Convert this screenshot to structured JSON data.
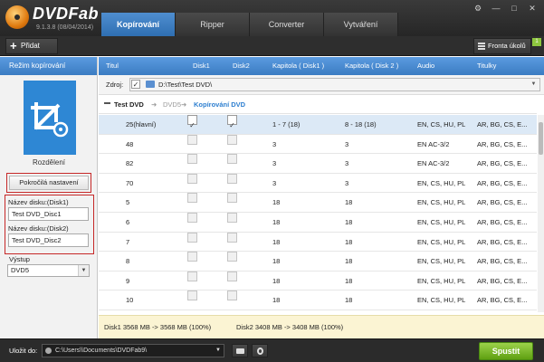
{
  "app": {
    "logo_text": "DVDFab",
    "version": "9.1.3.8 (08/04/2014)"
  },
  "tabs": [
    {
      "label": "Kopírování",
      "active": true
    },
    {
      "label": "Ripper",
      "active": false
    },
    {
      "label": "Converter",
      "active": false
    },
    {
      "label": "Vytváření",
      "active": false
    }
  ],
  "window_controls": {
    "settings": "⚙",
    "minimize": "—",
    "maximize": "□",
    "close": "✕"
  },
  "toolbar": {
    "add_label": "Přidat",
    "queue_label": "Fronta úkolů",
    "queue_count": "1"
  },
  "left_panel": {
    "header": "Režim kopírování",
    "mode_label": "Rozdělení",
    "advanced_button": "Pokročilá nastavení",
    "disk1_label": "Název disku:(Disk1)",
    "disk1_value": "Test DVD_Disc1",
    "disk2_label": "Název disku:(Disk2)",
    "disk2_value": "Test DVD_Disc2",
    "output_label": "Výstup",
    "output_value": "DVD5"
  },
  "columns": {
    "title": "Titul",
    "disk1": "Disk1",
    "disk2": "Disk2",
    "chapter1": "Kapitola ( Disk1 )",
    "chapter2": "Kapitola ( Disk 2 )",
    "audio": "Audio",
    "subtitles": "Titulky"
  },
  "source": {
    "label": "Zdroj:",
    "path": "D:\\Test\\Test DVD\\"
  },
  "breadcrumb": {
    "title": "Test DVD",
    "arrow": "➜",
    "volume": "DVD5",
    "mode": "Kopírování DVD"
  },
  "rows": [
    {
      "title": "25(hlavní)",
      "disk1": true,
      "disk2": true,
      "ch1": "1 - 7 (18)",
      "ch2": "8 - 18 (18)",
      "audio": "EN, CS, HU, PL",
      "subs": "AR, BG, CS, E...",
      "selected": true
    },
    {
      "title": "48",
      "disk1": false,
      "disk2": false,
      "ch1": "3",
      "ch2": "3",
      "audio": "EN AC-3/2",
      "subs": "AR, BG, CS, E...",
      "selected": false
    },
    {
      "title": "82",
      "disk1": false,
      "disk2": false,
      "ch1": "3",
      "ch2": "3",
      "audio": "EN AC-3/2",
      "subs": "AR, BG, CS, E...",
      "selected": false
    },
    {
      "title": "70",
      "disk1": false,
      "disk2": false,
      "ch1": "3",
      "ch2": "3",
      "audio": "EN, CS, HU, PL",
      "subs": "AR, BG, CS, E...",
      "selected": false
    },
    {
      "title": "5",
      "disk1": false,
      "disk2": false,
      "ch1": "18",
      "ch2": "18",
      "audio": "EN, CS, HU, PL",
      "subs": "AR, BG, CS, E...",
      "selected": false
    },
    {
      "title": "6",
      "disk1": false,
      "disk2": false,
      "ch1": "18",
      "ch2": "18",
      "audio": "EN, CS, HU, PL",
      "subs": "AR, BG, CS, E...",
      "selected": false
    },
    {
      "title": "7",
      "disk1": false,
      "disk2": false,
      "ch1": "18",
      "ch2": "18",
      "audio": "EN, CS, HU, PL",
      "subs": "AR, BG, CS, E...",
      "selected": false
    },
    {
      "title": "8",
      "disk1": false,
      "disk2": false,
      "ch1": "18",
      "ch2": "18",
      "audio": "EN, CS, HU, PL",
      "subs": "AR, BG, CS, E...",
      "selected": false
    },
    {
      "title": "9",
      "disk1": false,
      "disk2": false,
      "ch1": "18",
      "ch2": "18",
      "audio": "EN, CS, HU, PL",
      "subs": "AR, BG, CS, E...",
      "selected": false
    },
    {
      "title": "10",
      "disk1": false,
      "disk2": false,
      "ch1": "18",
      "ch2": "18",
      "audio": "EN, CS, HU, PL",
      "subs": "AR, BG, CS, E...",
      "selected": false
    }
  ],
  "status": {
    "disk1": "Disk1  3568 MB  ->  3568 MB  (100%)",
    "disk2": "Disk2  3408 MB  ->  3408 MB  (100%)"
  },
  "bottom": {
    "save_label": "Uložit do:",
    "save_path": "C:\\Users\\\\Documents\\DVDFab9\\",
    "start_label": "Spustit"
  },
  "colors": {
    "accent_blue": "#3b7cc2",
    "start_green": "#7cbf2a",
    "highlight_red": "#c62828",
    "status_bg": "#fbf4d3"
  }
}
